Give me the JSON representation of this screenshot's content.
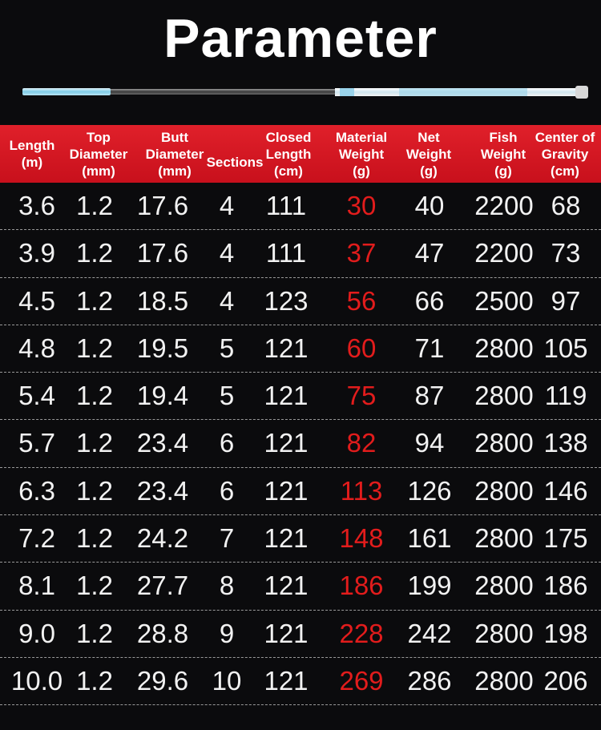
{
  "title": "Parameter",
  "colors": {
    "header_bg": "#d41620",
    "highlight": "#e21c1c",
    "background": "#0b0b0d"
  },
  "headers": [
    [
      "Length",
      "(m)"
    ],
    [
      "Top",
      "Diameter",
      "(mm)"
    ],
    [
      "Butt",
      "Diameter",
      "(mm)"
    ],
    [
      "Sections"
    ],
    [
      "Closed",
      "Length",
      "(cm)"
    ],
    [
      "Material",
      "Weight",
      "(g)"
    ],
    [
      "Net",
      "Weight",
      "(g)"
    ],
    [
      "Fish",
      "Weight",
      "(g)"
    ],
    [
      "Center of",
      "Gravity",
      "(cm)"
    ]
  ],
  "rows": [
    [
      "3.6",
      "1.2",
      "17.6",
      "4",
      "111",
      "30",
      "40",
      "2200",
      "68"
    ],
    [
      "3.9",
      "1.2",
      "17.6",
      "4",
      "111",
      "37",
      "47",
      "2200",
      "73"
    ],
    [
      "4.5",
      "1.2",
      "18.5",
      "4",
      "123",
      "56",
      "66",
      "2500",
      "97"
    ],
    [
      "4.8",
      "1.2",
      "19.5",
      "5",
      "121",
      "60",
      "71",
      "2800",
      "105"
    ],
    [
      "5.4",
      "1.2",
      "19.4",
      "5",
      "121",
      "75",
      "87",
      "2800",
      "119"
    ],
    [
      "5.7",
      "1.2",
      "23.4",
      "6",
      "121",
      "82",
      "94",
      "2800",
      "138"
    ],
    [
      "6.3",
      "1.2",
      "23.4",
      "6",
      "121",
      "113",
      "126",
      "2800",
      "146"
    ],
    [
      "7.2",
      "1.2",
      "24.2",
      "7",
      "121",
      "148",
      "161",
      "2800",
      "175"
    ],
    [
      "8.1",
      "1.2",
      "27.7",
      "8",
      "121",
      "186",
      "199",
      "2800",
      "186"
    ],
    [
      "9.0",
      "1.2",
      "28.8",
      "9",
      "121",
      "228",
      "242",
      "2800",
      "198"
    ],
    [
      "10.0",
      "1.2",
      "29.6",
      "10",
      "121",
      "269",
      "286",
      "2800",
      "206"
    ]
  ]
}
